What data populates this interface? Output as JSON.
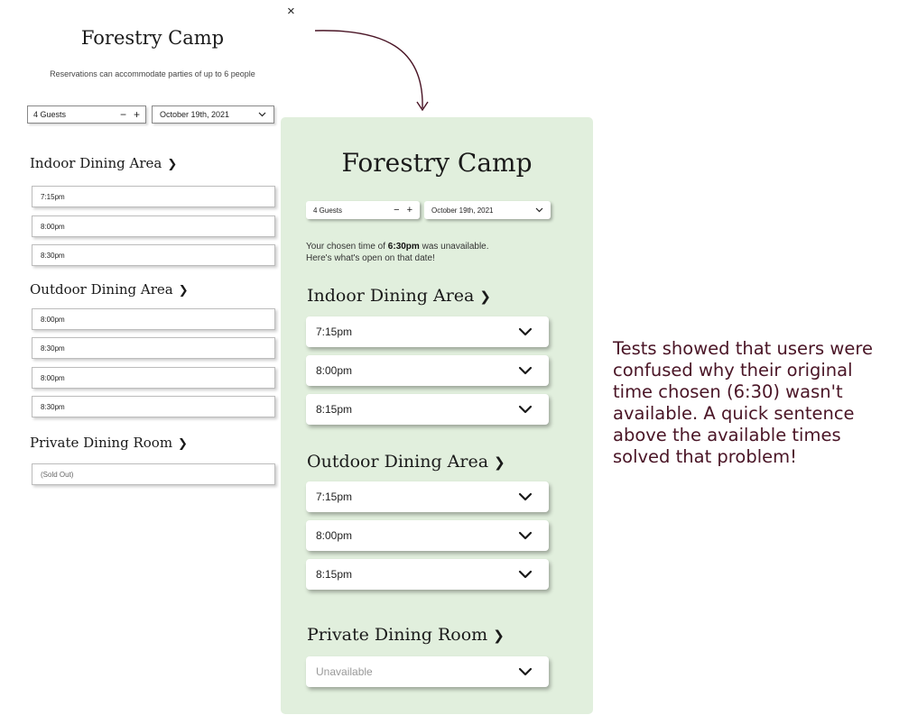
{
  "close_mark": "×",
  "old_version": {
    "title": "Forestry Camp",
    "subtitle": "Reservations can accommodate parties of up to 6 people",
    "guests": {
      "label": "4 Guests",
      "minus": "−",
      "plus": "+"
    },
    "date": {
      "label": "October 19th, 2021"
    },
    "sections": [
      {
        "name": "Indoor Dining Area",
        "slots": [
          "7:15pm",
          "8:00pm",
          "8:30pm"
        ]
      },
      {
        "name": "Outdoor Dining Area",
        "slots": [
          "8:00pm",
          "8:30pm",
          "8:00pm",
          "8:30pm"
        ]
      },
      {
        "name": "Private Dining Room",
        "slots": [
          "(Sold Out)"
        ]
      }
    ]
  },
  "new_version": {
    "title": "Forestry Camp",
    "guests": {
      "label": "4 Guests",
      "minus": "−",
      "plus": "+"
    },
    "date": {
      "label": "October 19th, 2021"
    },
    "note": {
      "prefix": "Your chosen time of ",
      "time": "6:30pm",
      "suffix": " was unavailable.",
      "line2": "Here's what's open on that date!"
    },
    "sections": [
      {
        "name": "Indoor Dining Area",
        "slots": [
          "7:15pm",
          "8:00pm",
          "8:15pm"
        ]
      },
      {
        "name": "Outdoor Dining Area",
        "slots": [
          "7:15pm",
          "8:00pm",
          "8:15pm"
        ]
      },
      {
        "name": "Private Dining Room",
        "slots": [
          "Unavailable"
        ]
      }
    ]
  },
  "annotation": "Tests showed that users were confused why their original time chosen (6:30) wasn't available. A quick sentence above the available times solved that problem!",
  "colors": {
    "panel_bg": "#e1efdd",
    "annotation_text": "#4a1526",
    "arrow": "#4a1526"
  }
}
